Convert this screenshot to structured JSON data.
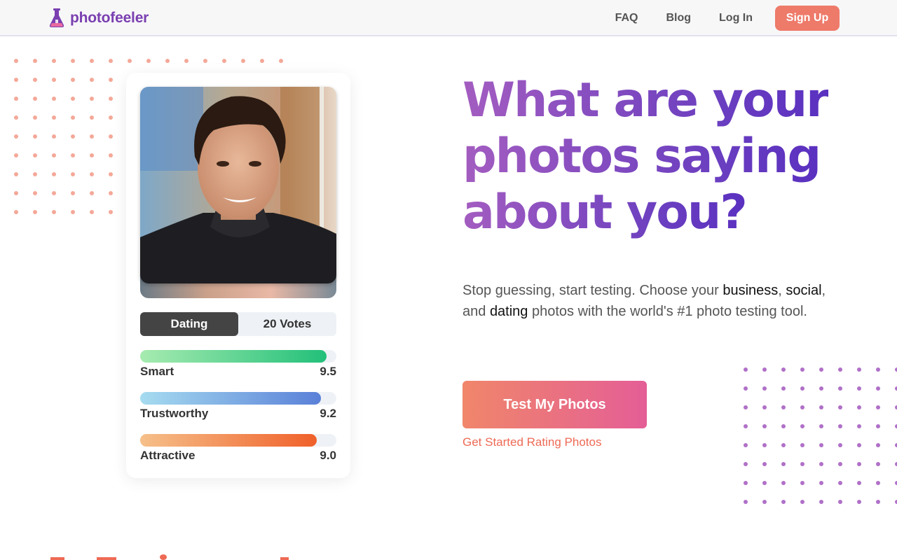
{
  "header": {
    "logo_text": "photofeeler",
    "logo_icon": "flask-icon",
    "nav": [
      {
        "label": "FAQ"
      },
      {
        "label": "Blog"
      },
      {
        "label": "Log In"
      }
    ],
    "signup_label": "Sign Up",
    "signup_color": "#ee7a6a"
  },
  "card": {
    "tabs": {
      "active": "Dating",
      "votes": "20 Votes"
    },
    "ratings": [
      {
        "label": "Smart",
        "score": "9.5",
        "fill": 0.95,
        "from": "#a7ebb0",
        "to": "#22c07a"
      },
      {
        "label": "Trustworthy",
        "score": "9.2",
        "fill": 0.92,
        "from": "#a6dcf0",
        "to": "#5a80d8"
      },
      {
        "label": "Attractive",
        "score": "9.0",
        "fill": 0.9,
        "from": "#f6c08a",
        "to": "#f0602a"
      }
    ]
  },
  "hero": {
    "headline": [
      "What are your",
      "photos saying",
      "about you?"
    ],
    "sub": {
      "part1": "Stop guessing, start testing. Choose your ",
      "business": "business",
      "part2": ", ",
      "social": "social",
      "part3": ", and ",
      "dating": "dating",
      "part4": " photos with the world's #1 photo testing tool."
    },
    "cta_label": "Test My Photos",
    "cta_link": "Get Started Rating Photos"
  },
  "colors": {
    "brand_purple": "#7a3fb0",
    "dots_salmon": "#f4a898",
    "dots_purple": "#b070c8"
  }
}
